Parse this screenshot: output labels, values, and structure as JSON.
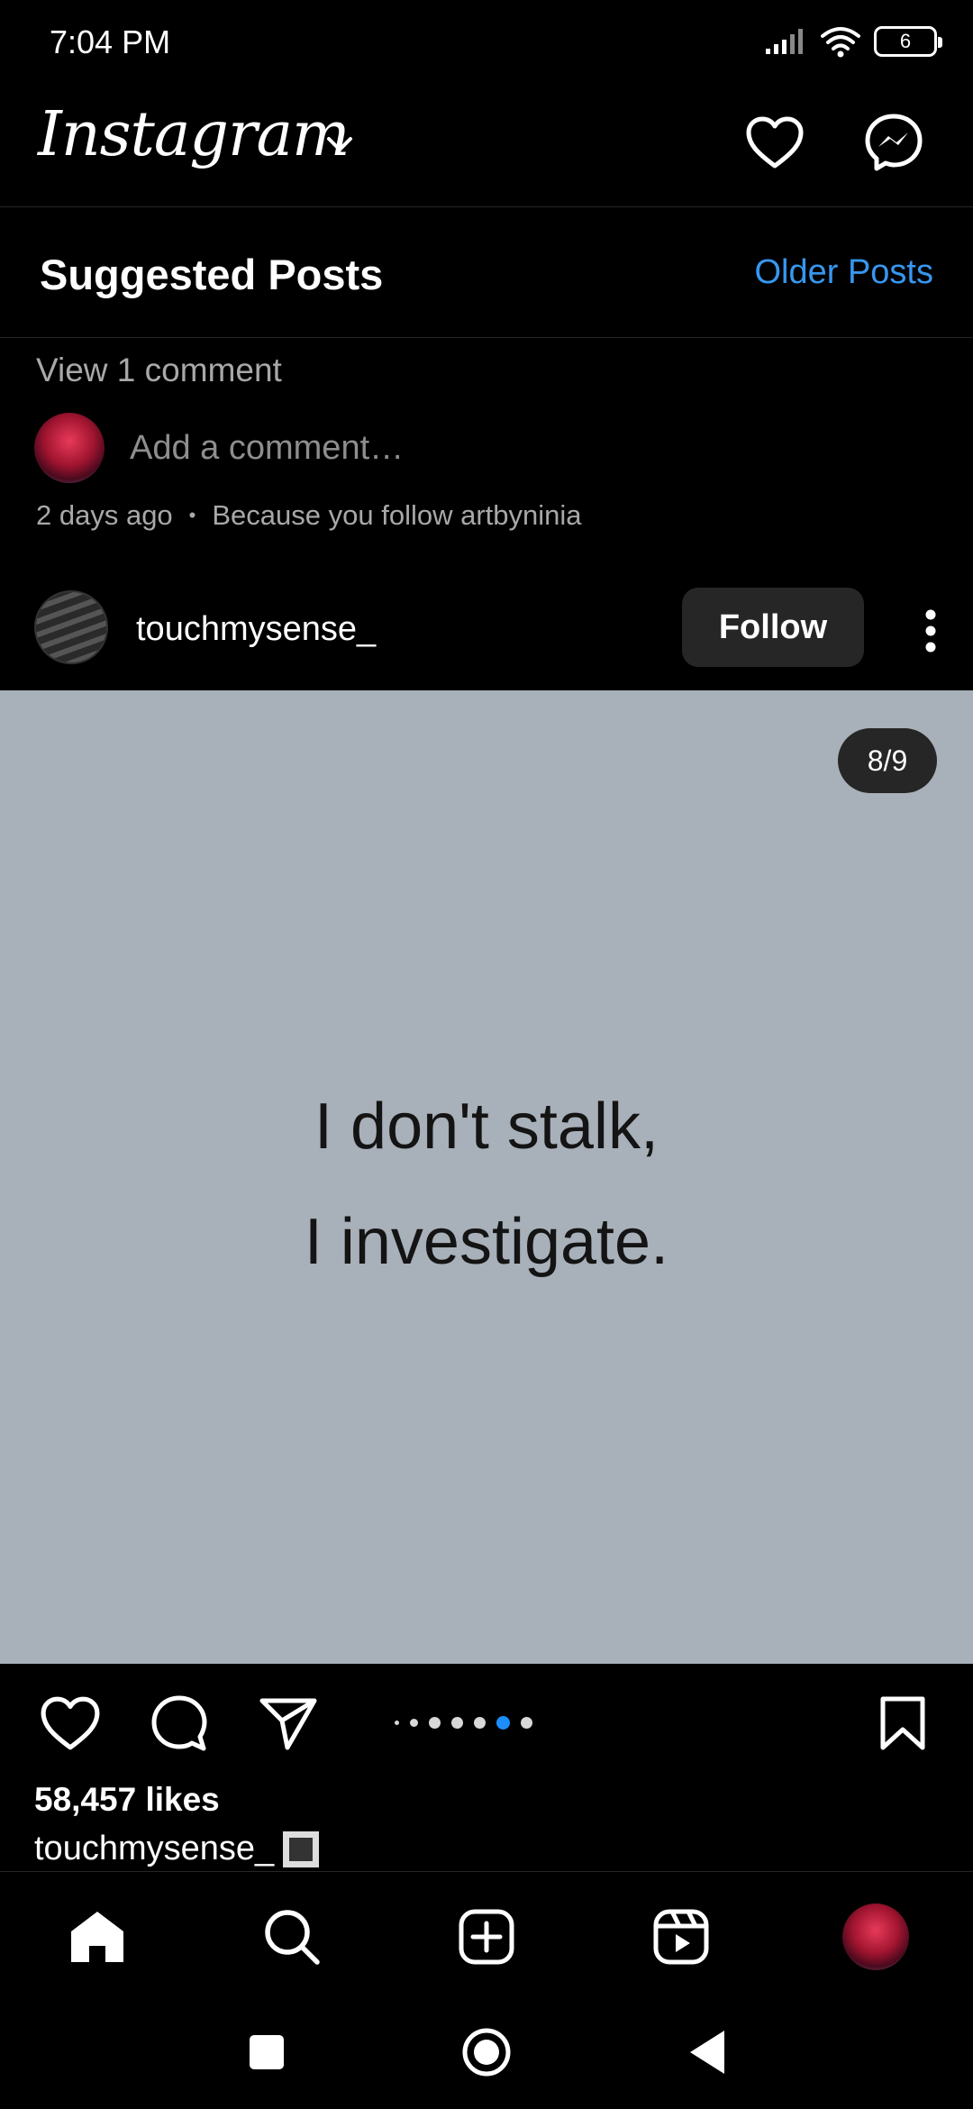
{
  "status_bar": {
    "time": "7:04 PM",
    "battery_level": "6",
    "icons": [
      "signal-icon",
      "wifi-icon",
      "battery-icon"
    ]
  },
  "header": {
    "logo_text": "Instagram",
    "icons": [
      "chevron-down-icon",
      "heart-icon",
      "messenger-icon"
    ]
  },
  "suggested": {
    "title": "Suggested Posts",
    "older_link": "Older Posts"
  },
  "previous_post": {
    "view_comments": "View 1 comment",
    "add_comment_placeholder": "Add a comment…",
    "time_ago": "2 days ago",
    "reason": "Because you follow artbyninia"
  },
  "post": {
    "username": "touchmysense_",
    "follow_label": "Follow",
    "counter": "8/9",
    "quote_line1": "I don't stalk,",
    "quote_line2": "I investigate.",
    "image_background": "#a8b0b9",
    "likes": "58,457 likes",
    "caption_user": "touchmysense_",
    "carousel_active_index": 5,
    "carousel_dot_count": 7
  },
  "bottom_nav": {
    "items": [
      "home-icon",
      "search-icon",
      "create-icon",
      "reels-icon",
      "profile-avatar"
    ]
  },
  "system_nav": [
    "recents-button",
    "home-button",
    "back-button"
  ],
  "colors": {
    "accent": "#3797f0",
    "active_dot": "#1c8ef9",
    "background": "#000000",
    "button_bg": "#262626"
  }
}
